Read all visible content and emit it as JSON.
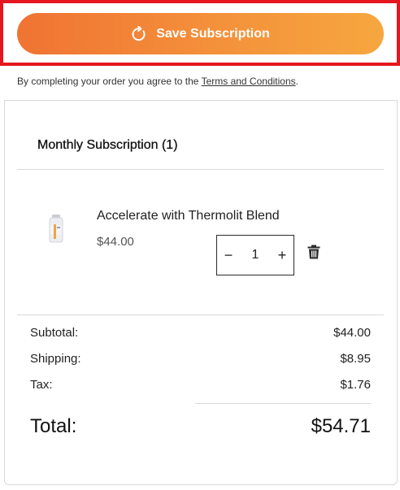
{
  "save_button": {
    "label": "Save Subscription",
    "icon": "refresh-icon"
  },
  "terms": {
    "prefix": "By completing your order you agree to the ",
    "link": "Terms and Conditions",
    "suffix": "."
  },
  "subscription": {
    "title": "Monthly Subscription (1)"
  },
  "item": {
    "name": "Accelerate with Thermolit Blend",
    "price": "$44.00",
    "quantity": "1",
    "decrement": "−",
    "increment": "+"
  },
  "summary": {
    "subtotal_label": "Subtotal:",
    "subtotal_value": "$44.00",
    "shipping_label": "Shipping:",
    "shipping_value": "$8.95",
    "tax_label": "Tax:",
    "tax_value": "$1.76",
    "total_label": "Total:",
    "total_value": "$54.71"
  },
  "colors": {
    "accent_start": "#f07332",
    "accent_end": "#f6a73f",
    "highlight": "#e5161f"
  }
}
